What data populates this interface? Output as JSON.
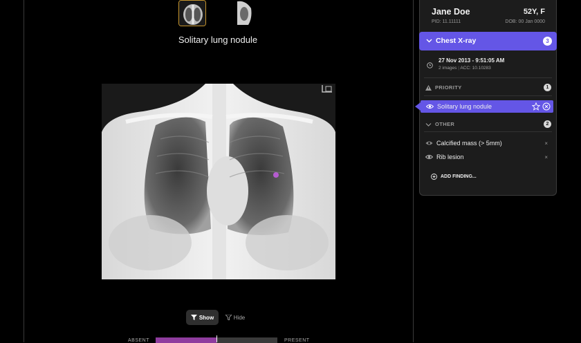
{
  "thumbnails": [
    {
      "name": "frontal-view",
      "selected": true
    },
    {
      "name": "lateral-view",
      "selected": false
    }
  ],
  "finding_title": "Solitary lung nodule",
  "view_toggle": {
    "show_label": "Show",
    "hide_label": "Hide"
  },
  "scale": {
    "left_label": "ABSENT",
    "right_label": "PRESENT",
    "fill_fraction": 0.5
  },
  "patient": {
    "name": "Jane Doe",
    "age_sex": "52Y, F",
    "pid": "PID: 11.11111",
    "dob": "DOB: 00 Jan 0000"
  },
  "study": {
    "title": "Chest X-ray",
    "count": "3"
  },
  "exam": {
    "datetime": "27 Nov 2013 - 9:51:05 AM",
    "images": "2 images",
    "acc": "ACC: 10.10283"
  },
  "sections": {
    "priority": {
      "label": "PRIORITY",
      "count": "1"
    },
    "other": {
      "label": "OTHER",
      "count": "2"
    }
  },
  "findings": {
    "priority": [
      {
        "label": "Solitary lung nodule"
      }
    ],
    "other": [
      {
        "label": "Calcified mass (> 5mm)"
      },
      {
        "label": "Rib lesion"
      }
    ]
  },
  "add_finding": "ADD FINDING...",
  "colors": {
    "accent": "#6456e6",
    "highlight": "#c8962d",
    "nodule_marker": "#b45ccf"
  }
}
